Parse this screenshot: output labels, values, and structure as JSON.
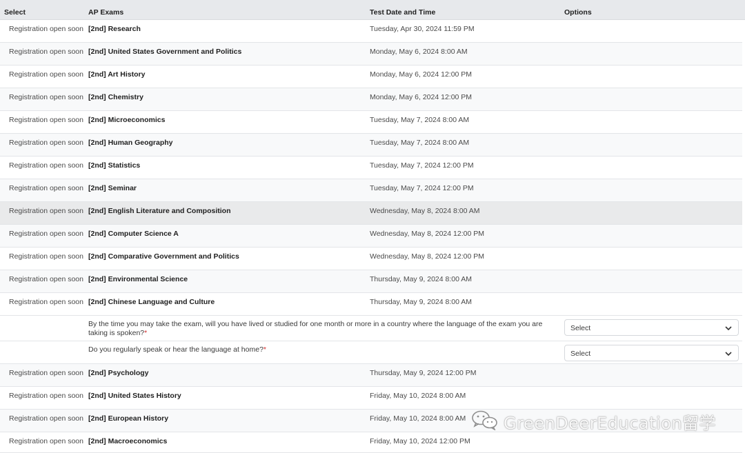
{
  "table": {
    "headers": {
      "select": "Select",
      "exams": "AP Exams",
      "date": "Test Date and Time",
      "options": "Options"
    },
    "rows": [
      {
        "status": "Registration open soon",
        "exam": "[2nd] Research",
        "date": "Tuesday, Apr 30, 2024 11:59 PM"
      },
      {
        "status": "Registration open soon",
        "exam": "[2nd] United States Government and Politics",
        "date": "Monday, May 6, 2024 8:00 AM"
      },
      {
        "status": "Registration open soon",
        "exam": "[2nd] Art History",
        "date": "Monday, May 6, 2024 12:00 PM"
      },
      {
        "status": "Registration open soon",
        "exam": "[2nd] Chemistry",
        "date": "Monday, May 6, 2024 12:00 PM"
      },
      {
        "status": "Registration open soon",
        "exam": "[2nd] Microeconomics",
        "date": "Tuesday, May 7, 2024 8:00 AM"
      },
      {
        "status": "Registration open soon",
        "exam": "[2nd] Human Geography",
        "date": "Tuesday, May 7, 2024 8:00 AM"
      },
      {
        "status": "Registration open soon",
        "exam": "[2nd] Statistics",
        "date": "Tuesday, May 7, 2024 12:00 PM"
      },
      {
        "status": "Registration open soon",
        "exam": "[2nd] Seminar",
        "date": "Tuesday, May 7, 2024 12:00 PM"
      },
      {
        "status": "Registration open soon",
        "exam": "[2nd] English Literature and Composition",
        "date": "Wednesday, May 8, 2024 8:00 AM"
      },
      {
        "status": "Registration open soon",
        "exam": "[2nd] Computer Science A",
        "date": "Wednesday, May 8, 2024 12:00 PM"
      },
      {
        "status": "Registration open soon",
        "exam": "[2nd] Comparative Government and Politics",
        "date": "Wednesday, May 8, 2024 12:00 PM"
      },
      {
        "status": "Registration open soon",
        "exam": "[2nd] Environmental Science",
        "date": "Thursday, May 9, 2024 8:00 AM"
      },
      {
        "status": "Registration open soon",
        "exam": "[2nd] Chinese Language and Culture",
        "date": "Thursday, May 9, 2024 8:00 AM"
      },
      {
        "status": "Registration open soon",
        "exam": "[2nd] Psychology",
        "date": "Thursday, May 9, 2024 12:00 PM"
      },
      {
        "status": "Registration open soon",
        "exam": "[2nd] United States History",
        "date": "Friday, May 10, 2024 8:00 AM"
      },
      {
        "status": "Registration open soon",
        "exam": "[2nd] European History",
        "date": "Friday, May 10, 2024 8:00 AM"
      },
      {
        "status": "Registration open soon",
        "exam": "[2nd] Macroeconomics",
        "date": "Friday, May 10, 2024 12:00 PM"
      }
    ],
    "questions": [
      {
        "text": "By the time you may take the exam, will you have lived or studied for one month or more in a country where the language of the exam you are taking is spoken?",
        "required_mark": "*",
        "select_value": "Select"
      },
      {
        "text": "Do you regularly speak or hear the language at home?",
        "required_mark": "*",
        "select_value": "Select"
      }
    ]
  },
  "watermark": {
    "text": "GreenDeerEducation留学",
    "icon": "wechat-icon"
  },
  "colors": {
    "header_bg": "#e7e9ec",
    "row_alt_bg": "#f8f9fa",
    "row_hover_bg": "#e9eaeb",
    "required": "#d32f2f"
  }
}
